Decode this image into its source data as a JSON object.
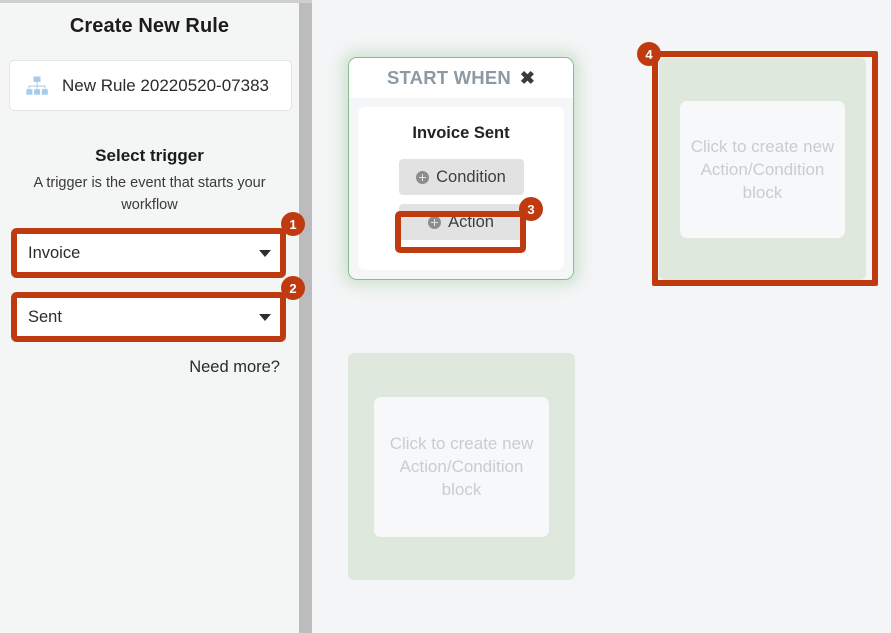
{
  "sidebar": {
    "panel_title": "Create New Rule",
    "rule_name": {
      "icon": "sitemap-icon",
      "value": "New Rule 20220520-07383"
    },
    "select_trigger": {
      "heading": "Select trigger",
      "description": "A trigger is the event that starts your workflow"
    },
    "dropdowns": [
      {
        "name": "trigger-object",
        "value": "Invoice",
        "caret_icon": "chevron-down-icon",
        "highlight_badge": "1"
      },
      {
        "name": "trigger-event",
        "value": "Sent",
        "caret_icon": "chevron-down-icon",
        "highlight_badge": "2"
      }
    ],
    "need_more_link": "Need more?"
  },
  "canvas": {
    "start_card": {
      "header_title": "START WHEN",
      "close_icon": "close-x-icon",
      "trigger_label": "Invoice Sent",
      "buttons": [
        {
          "label": "Condition",
          "icon": "plus-circle-icon"
        },
        {
          "label": "Action",
          "icon": "plus-circle-icon",
          "highlight_badge": "3"
        }
      ]
    },
    "drop_zones": [
      {
        "name": "upper-right-drop-zone",
        "placeholder": "Click to create new Action/Condition block",
        "highlight_badge": "4"
      },
      {
        "name": "lower-drop-zone",
        "placeholder": "Click to create new Action/Condition block"
      }
    ]
  },
  "badges": {
    "b1": "1",
    "b2": "2",
    "b3": "3",
    "b4": "4"
  },
  "colors": {
    "highlight": "#bf3a0f",
    "card_border_green": "#86bd8d",
    "zone_green": "#dfe8dd",
    "chip_gray": "#e2e2e2",
    "header_gray_blue": "#8d99a4",
    "canvas_bg": "#f4f5f6"
  }
}
